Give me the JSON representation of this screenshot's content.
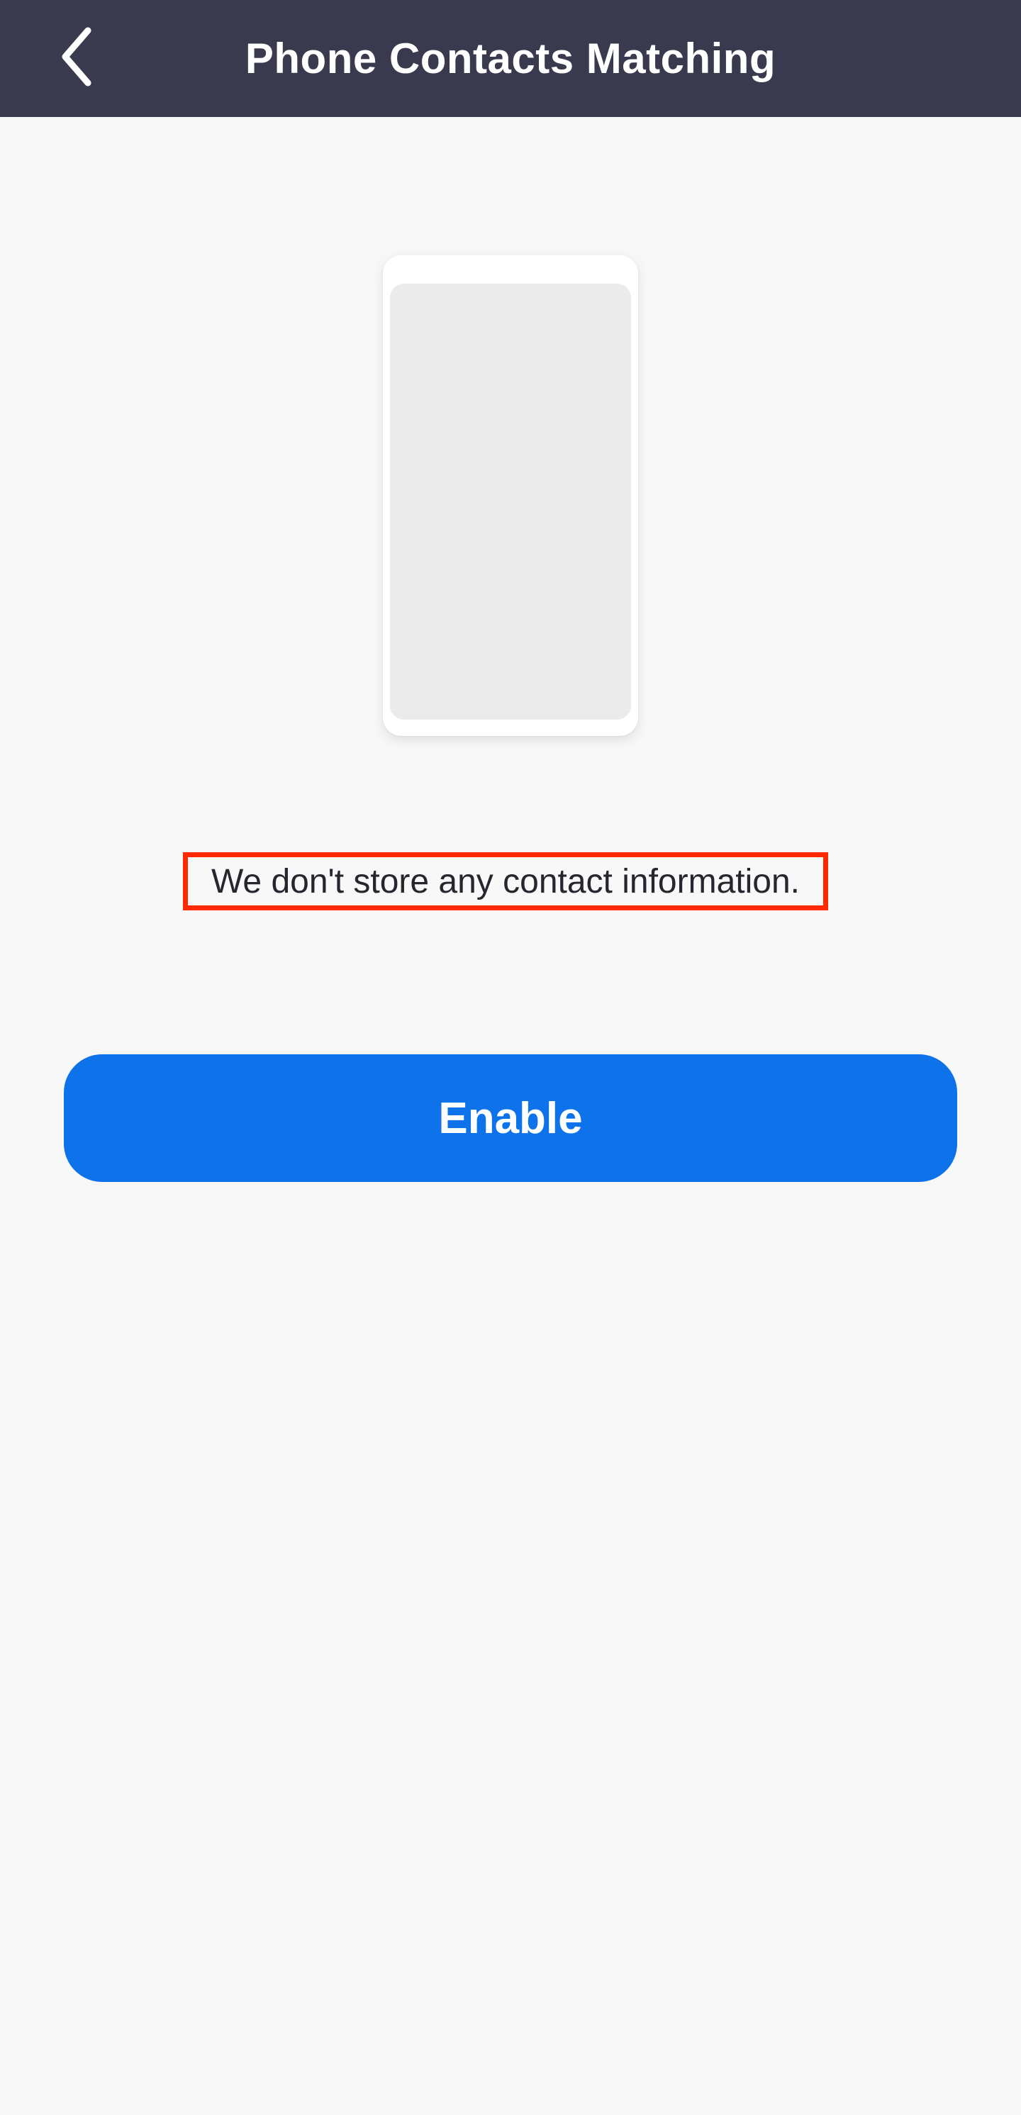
{
  "header": {
    "title": "Phone Contacts Matching",
    "back_icon": "chevron-left-icon"
  },
  "illustration": {
    "icon": "phone-illustration"
  },
  "main": {
    "info_text": "We don't store any contact information.",
    "enable_label": "Enable"
  },
  "colors": {
    "app_bar": "#393a4e",
    "background": "#f8f8f8",
    "primary_button": "#0e72ea",
    "highlight_border": "#ff2a00"
  }
}
